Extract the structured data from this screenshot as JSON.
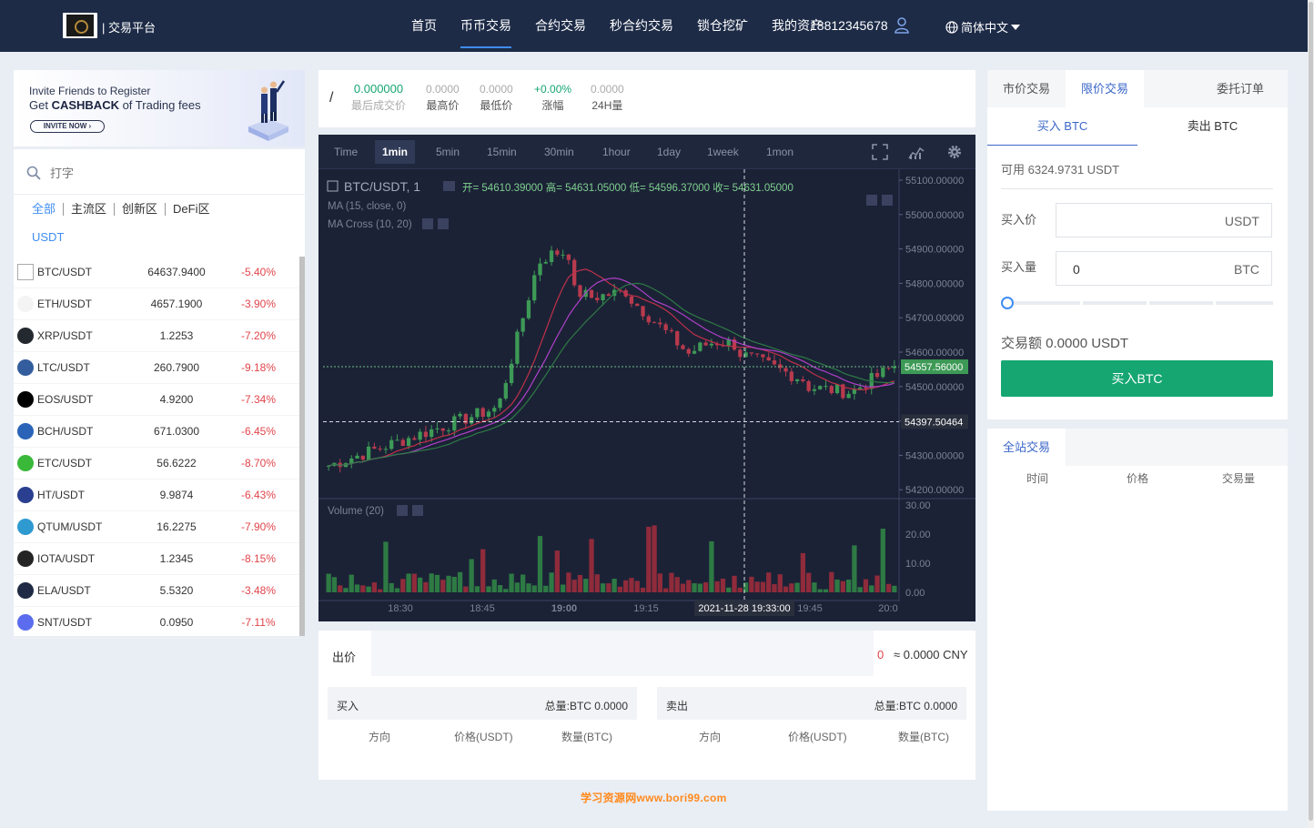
{
  "header": {
    "brand": "| 交易平台",
    "nav": [
      "首页",
      "币币交易",
      "合约交易",
      "秒合约交易",
      "锁仓挖矿",
      "我的资产"
    ],
    "phone": "18812345678",
    "language": "简体中文"
  },
  "banner": {
    "line1": "Invite Friends to Register",
    "line2_prefix": "Get ",
    "line2_bold": "CASHBACK",
    "line2_suffix": " of Trading fees",
    "button": "INVITE NOW ›"
  },
  "market": {
    "search_placeholder": "打字",
    "zones": [
      "全部",
      "主流区",
      "创新区",
      "DeFi区",
      "USDT"
    ],
    "coins": [
      {
        "pair": "BTC/USDT",
        "price": "64637.9400",
        "change": "-5.40%",
        "icon": "broken-image-icon",
        "color": "#ffffff"
      },
      {
        "pair": "ETH/USDT",
        "price": "4657.1900",
        "change": "-3.90%",
        "icon": "eth-icon",
        "color": "#f4f4f4"
      },
      {
        "pair": "XRP/USDT",
        "price": "1.2253",
        "change": "-7.20%",
        "icon": "xrp-icon",
        "color": "#23292f"
      },
      {
        "pair": "LTC/USDT",
        "price": "260.7900",
        "change": "-9.18%",
        "icon": "ltc-icon",
        "color": "#345d9d"
      },
      {
        "pair": "EOS/USDT",
        "price": "4.9200",
        "change": "-7.34%",
        "icon": "eos-icon",
        "color": "#000000"
      },
      {
        "pair": "BCH/USDT",
        "price": "671.0300",
        "change": "-6.45%",
        "icon": "bch-icon",
        "color": "#2a63b8"
      },
      {
        "pair": "ETC/USDT",
        "price": "56.6222",
        "change": "-8.70%",
        "icon": "etc-icon",
        "color": "#3ab83a"
      },
      {
        "pair": "HT/USDT",
        "price": "9.9874",
        "change": "-6.43%",
        "icon": "ht-icon",
        "color": "#2a3f8f"
      },
      {
        "pair": "QTUM/USDT",
        "price": "16.2275",
        "change": "-7.90%",
        "icon": "qtum-icon",
        "color": "#2e9ad0"
      },
      {
        "pair": "IOTA/USDT",
        "price": "1.2345",
        "change": "-8.15%",
        "icon": "iota-icon",
        "color": "#242424"
      },
      {
        "pair": "ELA/USDT",
        "price": "5.5320",
        "change": "-3.48%",
        "icon": "ela-icon",
        "color": "#1f2a44"
      },
      {
        "pair": "SNT/USDT",
        "price": "0.0950",
        "change": "-7.11%",
        "icon": "snt-icon",
        "color": "#5b6dee"
      }
    ]
  },
  "ticker": {
    "symbol": "/",
    "last_value": "0.000000",
    "last_label": "最后成交价",
    "high_value": "0.0000",
    "high_label": "最高价",
    "low_value": "0.0000",
    "low_label": "最低价",
    "change_value": "+0.00%",
    "change_label": "涨幅",
    "vol_value": "0.0000",
    "vol_label": "24H量",
    "accent_green": "#16a671"
  },
  "chart": {
    "timeframes": [
      "Time",
      "1min",
      "5min",
      "15min",
      "30min",
      "1hour",
      "1day",
      "1week",
      "1mon"
    ],
    "active_timeframe": "1min",
    "legend_symbol": "BTC/USDT, 1",
    "ohlc": "开= 54610.39000  高= 54631.05000  低= 54596.37000  收= 54631.05000",
    "ma_label": "MA (15, close, 0)",
    "macross_label": "MA Cross (10, 20)",
    "volume_label": "Volume (20)",
    "price_axis": [
      "55100.00000",
      "55000.00000",
      "54900.00000",
      "54800.00000",
      "54700.00000",
      "54600.00000",
      "54500.00000",
      "54400.00000",
      "54300.00000",
      "54200.00000"
    ],
    "volume_axis": [
      "30.00",
      "20.00",
      "10.00",
      "0.00"
    ],
    "time_axis": [
      "18:30",
      "18:45",
      "19:00",
      "19:15",
      "19:45",
      "20:0"
    ],
    "last_price_tag": "54557.56000",
    "crosshair_price_tag": "54397.50464",
    "crosshair_time_tag": "2021-11-28 19:33:00"
  },
  "chart_data": {
    "type": "candlestick",
    "xlabel": "",
    "ylabel": "",
    "y_range": [
      54200,
      55100
    ],
    "volume_range": [
      0,
      30
    ],
    "candles": [],
    "close_series_shape": "rise-from-54270-to-54920-then-decline-to-54530",
    "last_price": 54557.56
  },
  "orders": {
    "price_label": "出价",
    "zero": "0",
    "cny": "≈ 0.0000 CNY",
    "buy_title": "买入",
    "buy_total": "总量:BTC 0.0000",
    "sell_title": "卖出",
    "sell_total": "总量:BTC 0.0000",
    "headers": [
      "方向",
      "价格(USDT)",
      "数量(BTC)"
    ]
  },
  "watermark": "学习资源网www.bori99.com",
  "trade": {
    "tabs": [
      "市价交易",
      "限价交易",
      "委托订单"
    ],
    "side_tabs": [
      "买入 BTC",
      "卖出 BTC"
    ],
    "available": "可用 6324.9731 USDT",
    "price_label": "买入价",
    "price_unit": "USDT",
    "qty_label": "买入量",
    "qty_value": "0",
    "qty_unit": "BTC",
    "slider_value": 0,
    "amount": "交易额 0.0000 USDT",
    "buy_button": "买入BTC"
  },
  "site_trades": {
    "tab": "全站交易",
    "headers": [
      "时间",
      "价格",
      "交易量"
    ]
  }
}
